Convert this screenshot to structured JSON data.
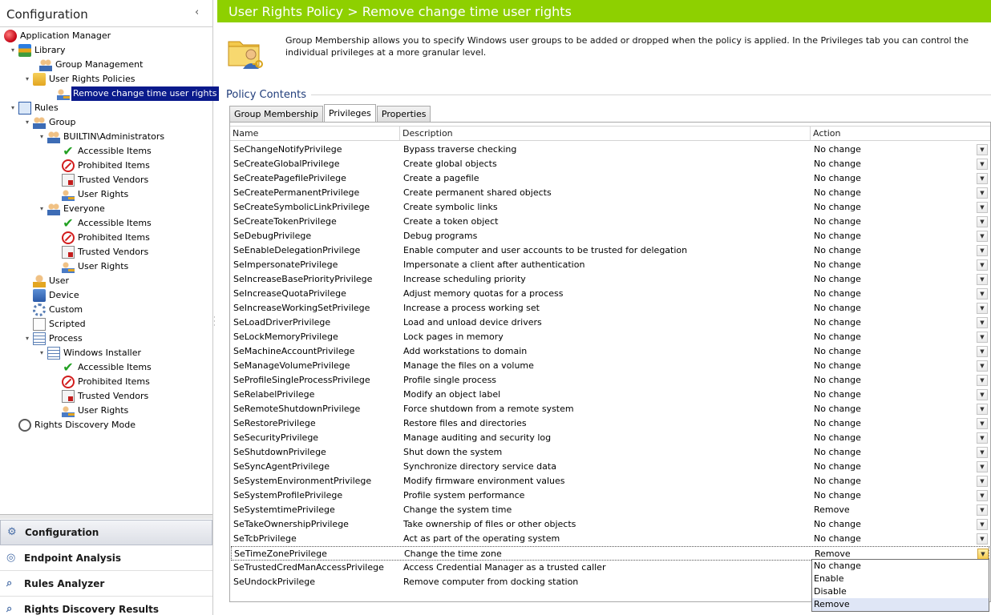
{
  "left_panel": {
    "title": "Configuration",
    "tree": [
      {
        "label": "Application Manager",
        "icon": "app-icon"
      },
      {
        "label": "Library",
        "icon": "books-icon"
      },
      {
        "label": "Group Management",
        "icon": "group-icon"
      },
      {
        "label": "User Rights Policies",
        "icon": "folder-key-icon"
      },
      {
        "label": "Remove change time user rights",
        "icon": "policy-key-icon"
      },
      {
        "label": "Rules",
        "icon": "rules-icon"
      },
      {
        "label": "Group",
        "icon": "group-icon"
      },
      {
        "label": "BUILTIN\\Administrators",
        "icon": "group-icon"
      },
      {
        "label": "Accessible Items",
        "icon": "check-icon"
      },
      {
        "label": "Prohibited Items",
        "icon": "prohibited-icon"
      },
      {
        "label": "Trusted Vendors",
        "icon": "trusted-doc-icon"
      },
      {
        "label": "User Rights",
        "icon": "user-key-icon"
      },
      {
        "label": "Everyone",
        "icon": "group-icon"
      },
      {
        "label": "Accessible Items",
        "icon": "check-icon"
      },
      {
        "label": "Prohibited Items",
        "icon": "prohibited-icon"
      },
      {
        "label": "Trusted Vendors",
        "icon": "trusted-doc-icon"
      },
      {
        "label": "User Rights",
        "icon": "user-key-icon"
      },
      {
        "label": "User",
        "icon": "user-icon"
      },
      {
        "label": "Device",
        "icon": "device-icon"
      },
      {
        "label": "Custom",
        "icon": "gear-icon"
      },
      {
        "label": "Scripted",
        "icon": "script-icon"
      },
      {
        "label": "Process",
        "icon": "process-icon"
      },
      {
        "label": "Windows Installer",
        "icon": "process-icon"
      },
      {
        "label": "Accessible Items",
        "icon": "check-icon"
      },
      {
        "label": "Prohibited Items",
        "icon": "prohibited-icon"
      },
      {
        "label": "Trusted Vendors",
        "icon": "trusted-doc-icon"
      },
      {
        "label": "User Rights",
        "icon": "user-key-icon"
      },
      {
        "label": "Rights Discovery Mode",
        "icon": "discovery-icon"
      }
    ],
    "nav": [
      {
        "label": "Configuration",
        "icon": "gear-icon"
      },
      {
        "label": "Endpoint Analysis",
        "icon": "endpoint-icon"
      },
      {
        "label": "Rules Analyzer",
        "icon": "analyzer-icon"
      },
      {
        "label": "Rights Discovery Results",
        "icon": "search-icon"
      }
    ]
  },
  "header": {
    "title": "User Rights Policy > Remove change time user rights",
    "color": "#8ed000"
  },
  "description": "Group Membership allows you to specify Windows user groups to be added or dropped when the policy is applied.  In the Privileges tab you can control the individual privileges at a more granular level.",
  "policy_contents_label": "Policy Contents",
  "tabs": [
    "Group Membership",
    "Privileges",
    "Properties"
  ],
  "active_tab": "Privileges",
  "grid": {
    "columns": [
      "Name",
      "Description",
      "Action"
    ],
    "rows": [
      [
        "SeChangeNotifyPrivilege",
        "Bypass traverse checking",
        "No change"
      ],
      [
        "SeCreateGlobalPrivilege",
        "Create global objects",
        "No change"
      ],
      [
        "SeCreatePagefilePrivilege",
        "Create a pagefile",
        "No change"
      ],
      [
        "SeCreatePermanentPrivilege",
        "Create permanent shared objects",
        "No change"
      ],
      [
        "SeCreateSymbolicLinkPrivilege",
        "Create symbolic links",
        "No change"
      ],
      [
        "SeCreateTokenPrivilege",
        "Create a token object",
        "No change"
      ],
      [
        "SeDebugPrivilege",
        "Debug programs",
        "No change"
      ],
      [
        "SeEnableDelegationPrivilege",
        "Enable computer and user accounts to be trusted for delegation",
        "No change"
      ],
      [
        "SeImpersonatePrivilege",
        "Impersonate a client after authentication",
        "No change"
      ],
      [
        "SeIncreaseBasePriorityPrivilege",
        "Increase scheduling priority",
        "No change"
      ],
      [
        "SeIncreaseQuotaPrivilege",
        "Adjust memory quotas for a process",
        "No change"
      ],
      [
        "SeIncreaseWorkingSetPrivilege",
        "Increase a process working set",
        "No change"
      ],
      [
        "SeLoadDriverPrivilege",
        "Load and unload device drivers",
        "No change"
      ],
      [
        "SeLockMemoryPrivilege",
        "Lock pages in memory",
        "No change"
      ],
      [
        "SeMachineAccountPrivilege",
        "Add workstations to domain",
        "No change"
      ],
      [
        "SeManageVolumePrivilege",
        "Manage the files on a volume",
        "No change"
      ],
      [
        "SeProfileSingleProcessPrivilege",
        "Profile single process",
        "No change"
      ],
      [
        "SeRelabelPrivilege",
        "Modify an object label",
        "No change"
      ],
      [
        "SeRemoteShutdownPrivilege",
        "Force shutdown from a remote system",
        "No change"
      ],
      [
        "SeRestorePrivilege",
        "Restore files and directories",
        "No change"
      ],
      [
        "SeSecurityPrivilege",
        "Manage auditing and security log",
        "No change"
      ],
      [
        "SeShutdownPrivilege",
        "Shut down the system",
        "No change"
      ],
      [
        "SeSyncAgentPrivilege",
        "Synchronize directory service data",
        "No change"
      ],
      [
        "SeSystemEnvironmentPrivilege",
        "Modify firmware environment values",
        "No change"
      ],
      [
        "SeSystemProfilePrivilege",
        "Profile system performance",
        "No change"
      ],
      [
        "SeSystemtimePrivilege",
        "Change the system time",
        "Remove"
      ],
      [
        "SeTakeOwnershipPrivilege",
        "Take ownership of files or other objects",
        "No change"
      ],
      [
        "SeTcbPrivilege",
        "Act as part of the operating system",
        "No change"
      ],
      [
        "SeTimeZonePrivilege",
        "Change the time zone",
        "Remove"
      ],
      [
        "SeTrustedCredManAccessPrivilege",
        "Access Credential Manager as a trusted caller",
        ""
      ],
      [
        "SeUndockPrivilege",
        "Remove computer from docking station",
        ""
      ]
    ],
    "selected_row": "SeTimeZonePrivilege"
  },
  "dropdown": {
    "options": [
      "No change",
      "Enable",
      "Disable",
      "Remove"
    ],
    "highlighted": "Remove"
  }
}
